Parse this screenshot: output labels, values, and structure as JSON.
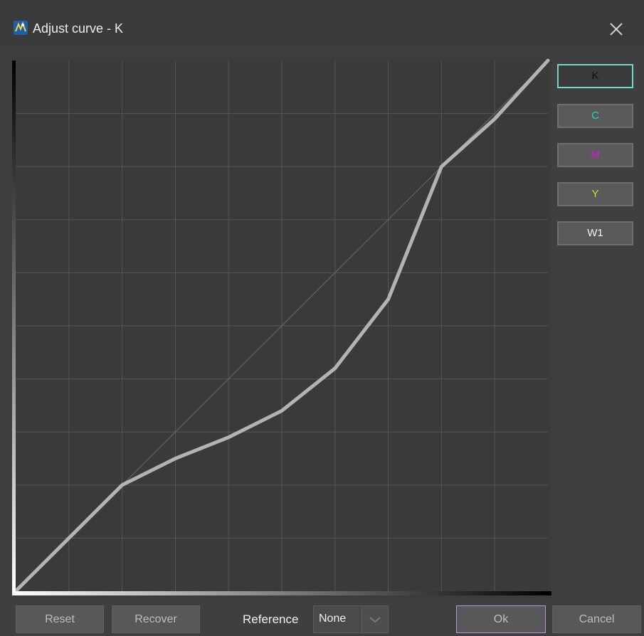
{
  "window": {
    "title": "Adjust curve - K",
    "app_icon": "app-logo-icon",
    "close_icon": "close-icon"
  },
  "channels": [
    {
      "label": "K",
      "color": "#111111",
      "active": true
    },
    {
      "label": "C",
      "color": "#2ad1d1",
      "active": false
    },
    {
      "label": "M",
      "color": "#d21bd2",
      "active": false
    },
    {
      "label": "Y",
      "color": "#d9d92a",
      "active": false
    },
    {
      "label": "W1",
      "color": "#f2f2f2",
      "active": false
    }
  ],
  "curve_points": [
    [
      0,
      0
    ],
    [
      0.2,
      0.2
    ],
    [
      0.3,
      0.25
    ],
    [
      0.4,
      0.29
    ],
    [
      0.5,
      0.34
    ],
    [
      0.6,
      0.42
    ],
    [
      0.7,
      0.55
    ],
    [
      0.8,
      0.8
    ],
    [
      0.9,
      0.89
    ],
    [
      1,
      1
    ]
  ],
  "footer": {
    "reset_label": "Reset",
    "recover_label": "Recover",
    "reference_label": "Reference",
    "reference_value": "None",
    "ok_label": "Ok",
    "cancel_label": "Cancel"
  },
  "colors": {
    "active_border": "#74d6c6",
    "ok_border": "#b496d6",
    "plot_bg": "#3a3a3a",
    "grid": "#555555",
    "curve": "#b3b3b3"
  }
}
